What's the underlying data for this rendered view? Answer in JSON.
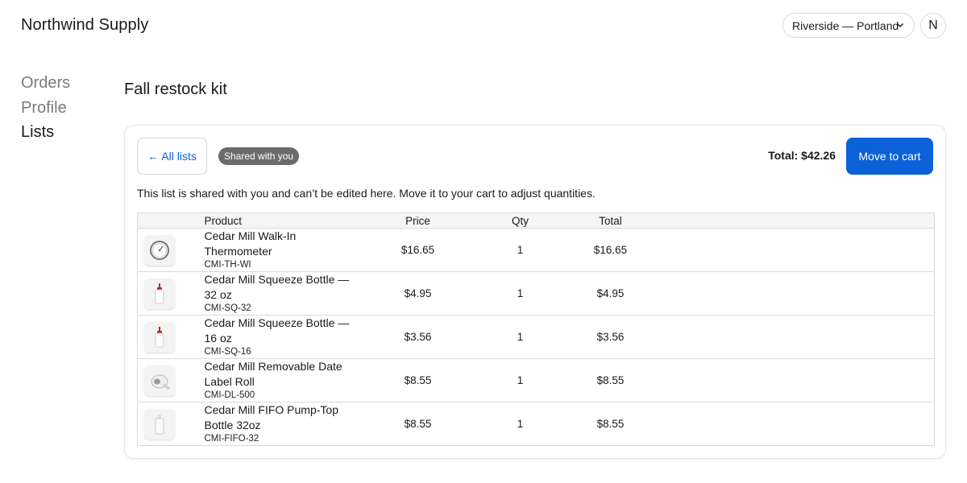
{
  "app": {
    "brand": "Northwind Supply"
  },
  "header": {
    "store_selector": "Riverside — Portland",
    "avatar_initial": "N"
  },
  "nav": {
    "items": [
      {
        "label": "Orders"
      },
      {
        "label": "Profile"
      },
      {
        "label": "Lists"
      }
    ]
  },
  "page": {
    "title": "Fall restock kit"
  },
  "list": {
    "back_label": "← All lists",
    "badge": "Shared with you",
    "total_label": "Total: $42.26",
    "move_label": "Move to cart",
    "notice": "This list is shared with you and can’t be edited here. Move it to your cart to adjust quantities.",
    "columns": {
      "product": "Product",
      "price": "Price",
      "qty": "Qty",
      "total": "Total"
    },
    "rows": [
      {
        "name_line1": "Cedar Mill Walk-In",
        "name_line2": "Thermometer",
        "sku": "CMI-TH-WI",
        "price": "$16.65",
        "qty": "1",
        "total": "$16.65",
        "icon": "thermometer-icon"
      },
      {
        "name_line1": "Cedar Mill Squeeze Bottle —",
        "name_line2": "32 oz",
        "sku": "CMI-SQ-32",
        "price": "$4.95",
        "qty": "1",
        "total": "$4.95",
        "icon": "squeeze-bottle-icon"
      },
      {
        "name_line1": "Cedar Mill Squeeze Bottle —",
        "name_line2": "16 oz",
        "sku": "CMI-SQ-16",
        "price": "$3.56",
        "qty": "1",
        "total": "$3.56",
        "icon": "squeeze-bottle-icon"
      },
      {
        "name_line1": "Cedar Mill Removable Date",
        "name_line2": "Label Roll",
        "sku": "CMI-DL-500",
        "price": "$8.55",
        "qty": "1",
        "total": "$8.55",
        "icon": "label-roll-icon"
      },
      {
        "name_line1": "Cedar Mill FIFO Pump-Top",
        "name_line2": "Bottle 32oz",
        "sku": "CMI-FIFO-32",
        "price": "$8.55",
        "qty": "1",
        "total": "$8.55",
        "icon": "pump-bottle-icon"
      }
    ]
  },
  "colors": {
    "accent": "#0b61d8",
    "badge_bg": "#6b6b6b",
    "muted_nav": "#7a7a7a"
  }
}
